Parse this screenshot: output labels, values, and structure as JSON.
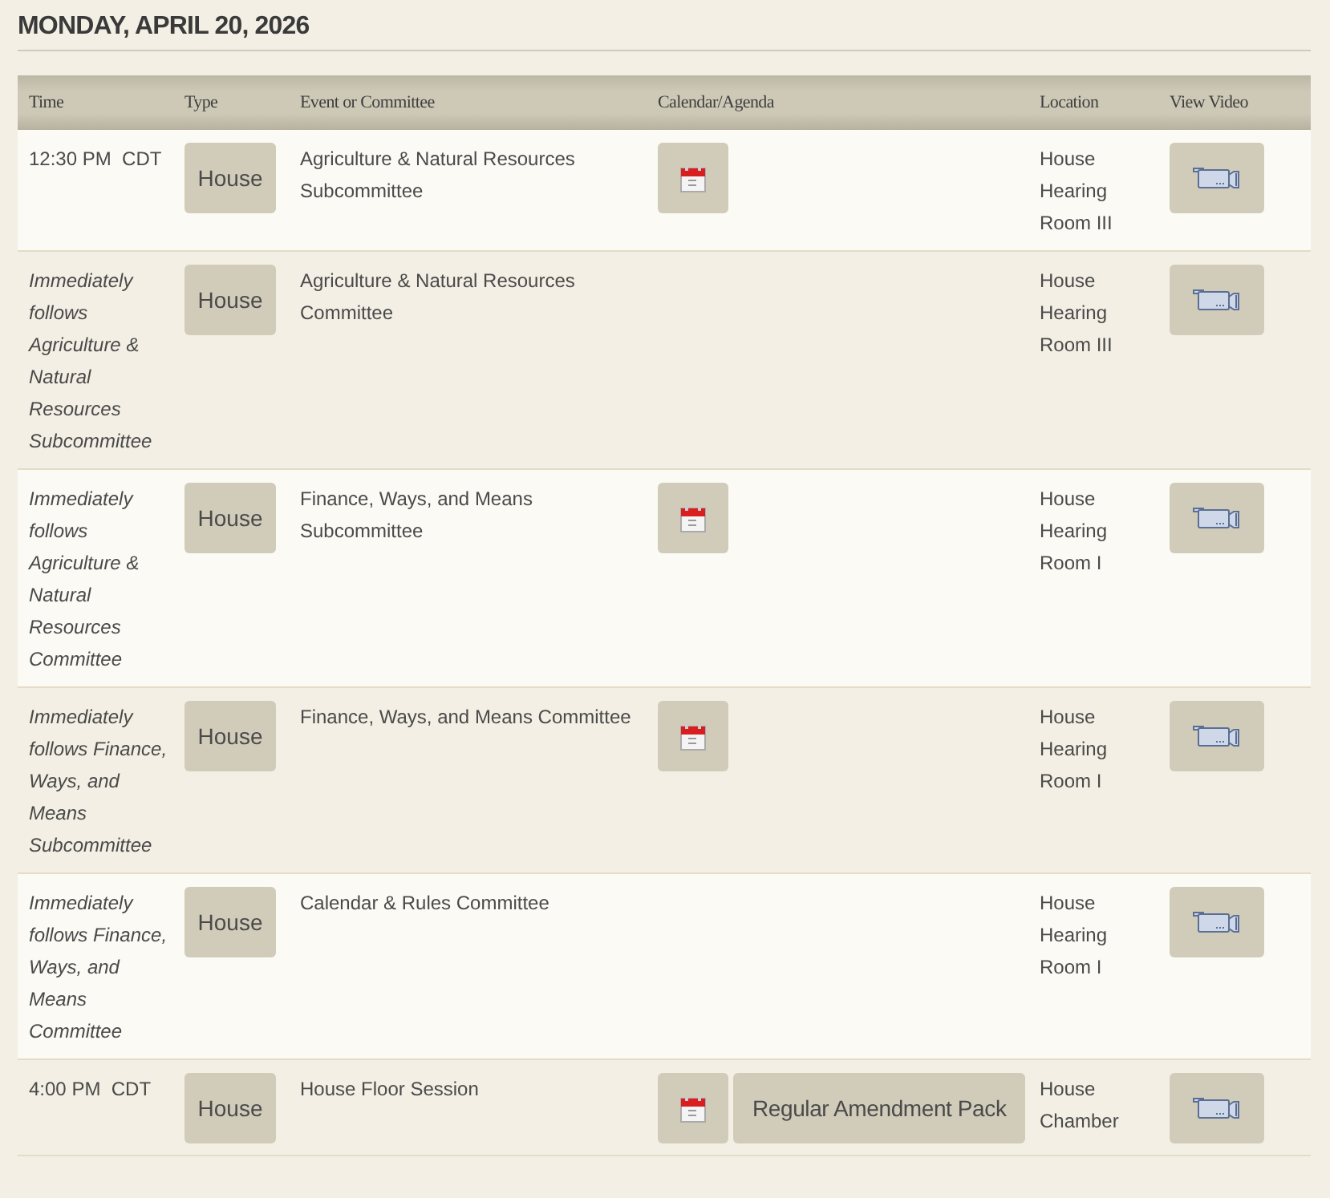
{
  "date_heading": "MONDAY, APRIL 20, 2026",
  "table": {
    "columns": [
      "Time",
      "Type",
      "Event or Committee",
      "Calendar/Agenda",
      "Location",
      "View Video"
    ],
    "rows": [
      {
        "time": "12:30 PM  CDT",
        "italic": false,
        "type": "House",
        "event": "Agriculture & Natural Resources Subcommittee",
        "has_calendar": true,
        "documents": [],
        "location": "House Hearing Room III",
        "has_video": true
      },
      {
        "time": "Immediately follows Agriculture & Natural Resources Subcommittee",
        "italic": true,
        "type": "House",
        "event": "Agriculture & Natural Resources Committee",
        "has_calendar": false,
        "documents": [],
        "location": "House Hearing Room III",
        "has_video": true
      },
      {
        "time": "Immediately follows Agriculture & Natural Resources Committee",
        "italic": true,
        "type": "House",
        "event": "Finance, Ways, and Means Subcommittee",
        "has_calendar": true,
        "documents": [],
        "location": "House Hearing Room I",
        "has_video": true
      },
      {
        "time": "Immediately follows Finance, Ways, and Means Subcommittee",
        "italic": true,
        "type": "House",
        "event": "Finance, Ways, and Means Committee",
        "has_calendar": true,
        "documents": [],
        "location": "House Hearing Room I",
        "has_video": true
      },
      {
        "time": "Immediately follows Finance, Ways, and Means Committee",
        "italic": true,
        "type": "House",
        "event": "Calendar & Rules Committee",
        "has_calendar": false,
        "documents": [],
        "location": "House Hearing Room I",
        "has_video": true
      },
      {
        "time": "4:00 PM  CDT",
        "italic": false,
        "type": "House",
        "event": "House Floor Session",
        "has_calendar": true,
        "documents": [
          "Regular Amendment Pack"
        ],
        "location": "House Chamber",
        "has_video": true
      }
    ]
  }
}
